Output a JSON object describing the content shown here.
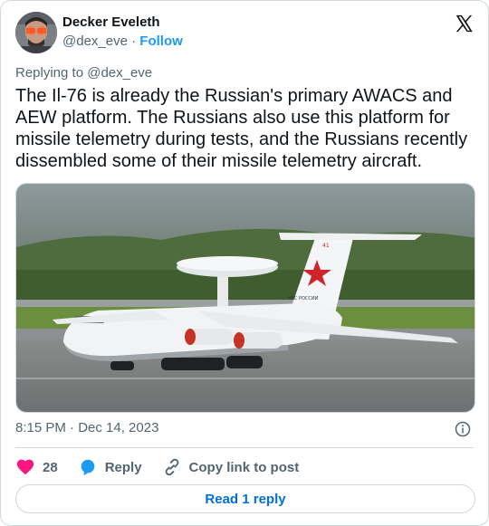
{
  "author": {
    "name": "Decker Eveleth",
    "handle": "@dex_eve",
    "separator": "·",
    "follow_label": "Follow"
  },
  "replying_to": "Replying to @dex_eve",
  "tweet": {
    "text": "The Il-76 is already the Russian's primary AWACS and AEW platform. The Russians also use this platform for missile telemetry during tests, and the Russians recently dissembled some of their missile telemetry aircraft."
  },
  "media": {
    "tail_marking": "ВВС РОССИИ",
    "tail_number": "41"
  },
  "timestamp": "8:15 PM · Dec 14, 2023",
  "actions": {
    "like_count": "28",
    "reply_label": "Reply",
    "copy_label": "Copy link to post"
  },
  "read_replies_label": "Read 1 reply",
  "colors": {
    "accent": "#1d9bf0",
    "like": "#f91880",
    "reply_button_text": "#006fd6",
    "secondary_text": "#536471"
  },
  "icons": [
    "x-logo-icon",
    "info-icon",
    "heart-icon",
    "reply-bubble-icon",
    "link-icon"
  ]
}
